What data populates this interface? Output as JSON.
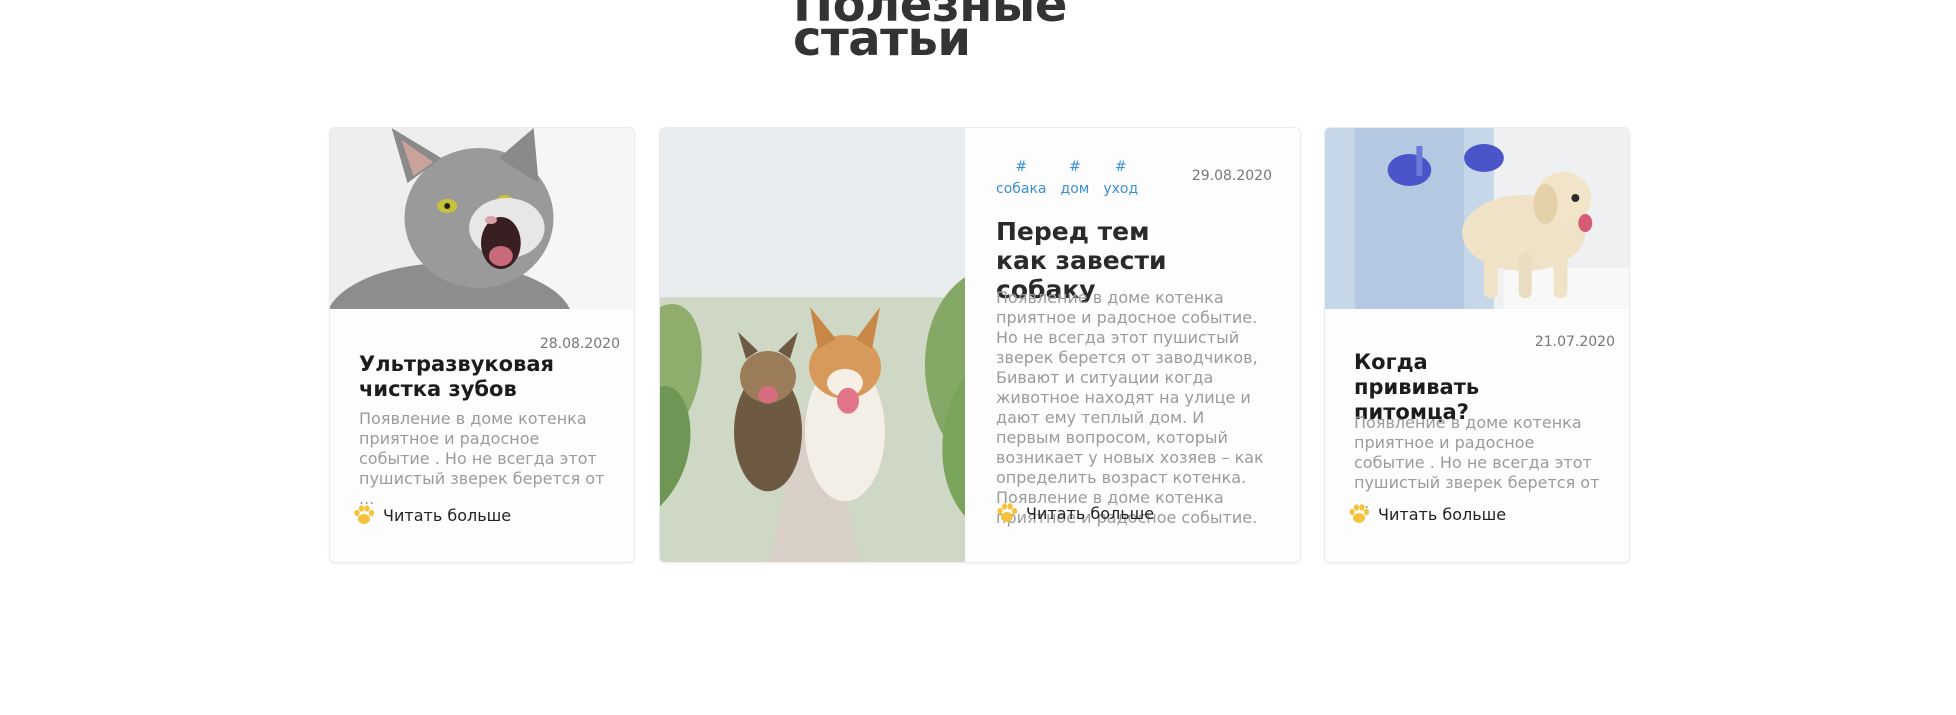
{
  "section": {
    "title": "Полезные статьи"
  },
  "colors": {
    "accent_tag": "#3b8fd9",
    "paw": "#f7c23b",
    "title": "#333333",
    "muted_text": "#9b9b9b"
  },
  "articles": [
    {
      "image": "cat-photo",
      "date": "28.08.2020",
      "title": "Ультразвуковая чистка зубов",
      "text": "Появление в доме котенка приятное и радосное событие . Но не всегда этот пушистый зверек берется от ...",
      "read_more": "Читать больше",
      "read_more_icon": "paw-icon"
    },
    {
      "image": "dogs-photo",
      "date": "29.08.2020",
      "tags": [
        {
          "hash": "#",
          "label": "собака"
        },
        {
          "hash": "#",
          "label": "дом"
        },
        {
          "hash": "#",
          "label": "уход"
        }
      ],
      "title": "Перед тем как завести собаку",
      "text": "Появление в доме котенка приятное и радосное событие. Но не всегда этот пушистый зверек берется от заводчиков, Бивают и ситуации когда животное находят на улице и дают ему теплый дом. И первым вопросом, который возникает у новых хозяев – как определить возраст котенка. Появление в доме котенка приятное и радосное событие.",
      "read_more": "Читать больше",
      "read_more_icon": "paw-icon"
    },
    {
      "image": "puppy-vet-photo",
      "date": "21.07.2020",
      "title": "Когда прививать питомца?",
      "text": "Появление в доме котенка приятное и радосное событие . Но не всегда этот пушистый зверек берется от ...",
      "read_more": "Читать больше",
      "read_more_icon": "paw-icon"
    }
  ]
}
